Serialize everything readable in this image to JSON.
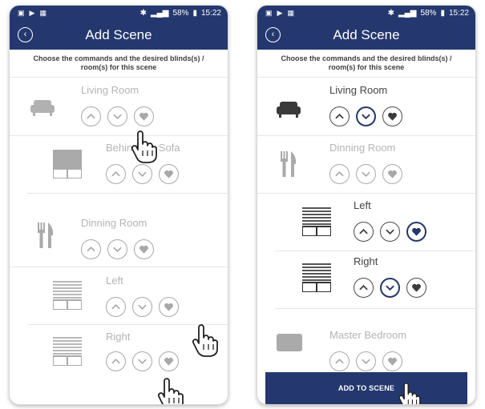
{
  "status": {
    "battery": "58%",
    "time": "15:22"
  },
  "screen": {
    "title": "Add Scene",
    "instruction_line1": "Choose the commands and the desired blinds(s) /",
    "instruction_line2": "room(s) for this scene"
  },
  "left_rooms": [
    {
      "label": "Living Room",
      "icon": "sofa-icon"
    },
    {
      "label": "Behind the Sofa",
      "icon": "blind-icon"
    },
    {
      "label": "Dinning Room",
      "icon": "fork-knife-icon"
    },
    {
      "label": "Left",
      "icon": "blind-icon"
    },
    {
      "label": "Right",
      "icon": "blind-icon"
    }
  ],
  "right_rooms": [
    {
      "label": "Living Room",
      "icon": "sofa-icon",
      "selected": "down"
    },
    {
      "label": "Dinning Room",
      "icon": "fork-knife-icon",
      "selected": "none"
    },
    {
      "label": "Left",
      "icon": "blind-icon",
      "selected": "favourite"
    },
    {
      "label": "Right",
      "icon": "blind-icon",
      "selected": "down"
    },
    {
      "label": "Master Bedroom",
      "icon": "bed-icon",
      "selected": "none"
    }
  ],
  "add_to_scene_label": "ADD TO SCENE",
  "colors": {
    "primary": "#24386f",
    "dim": "#b4b4b4",
    "text": "#444444"
  }
}
